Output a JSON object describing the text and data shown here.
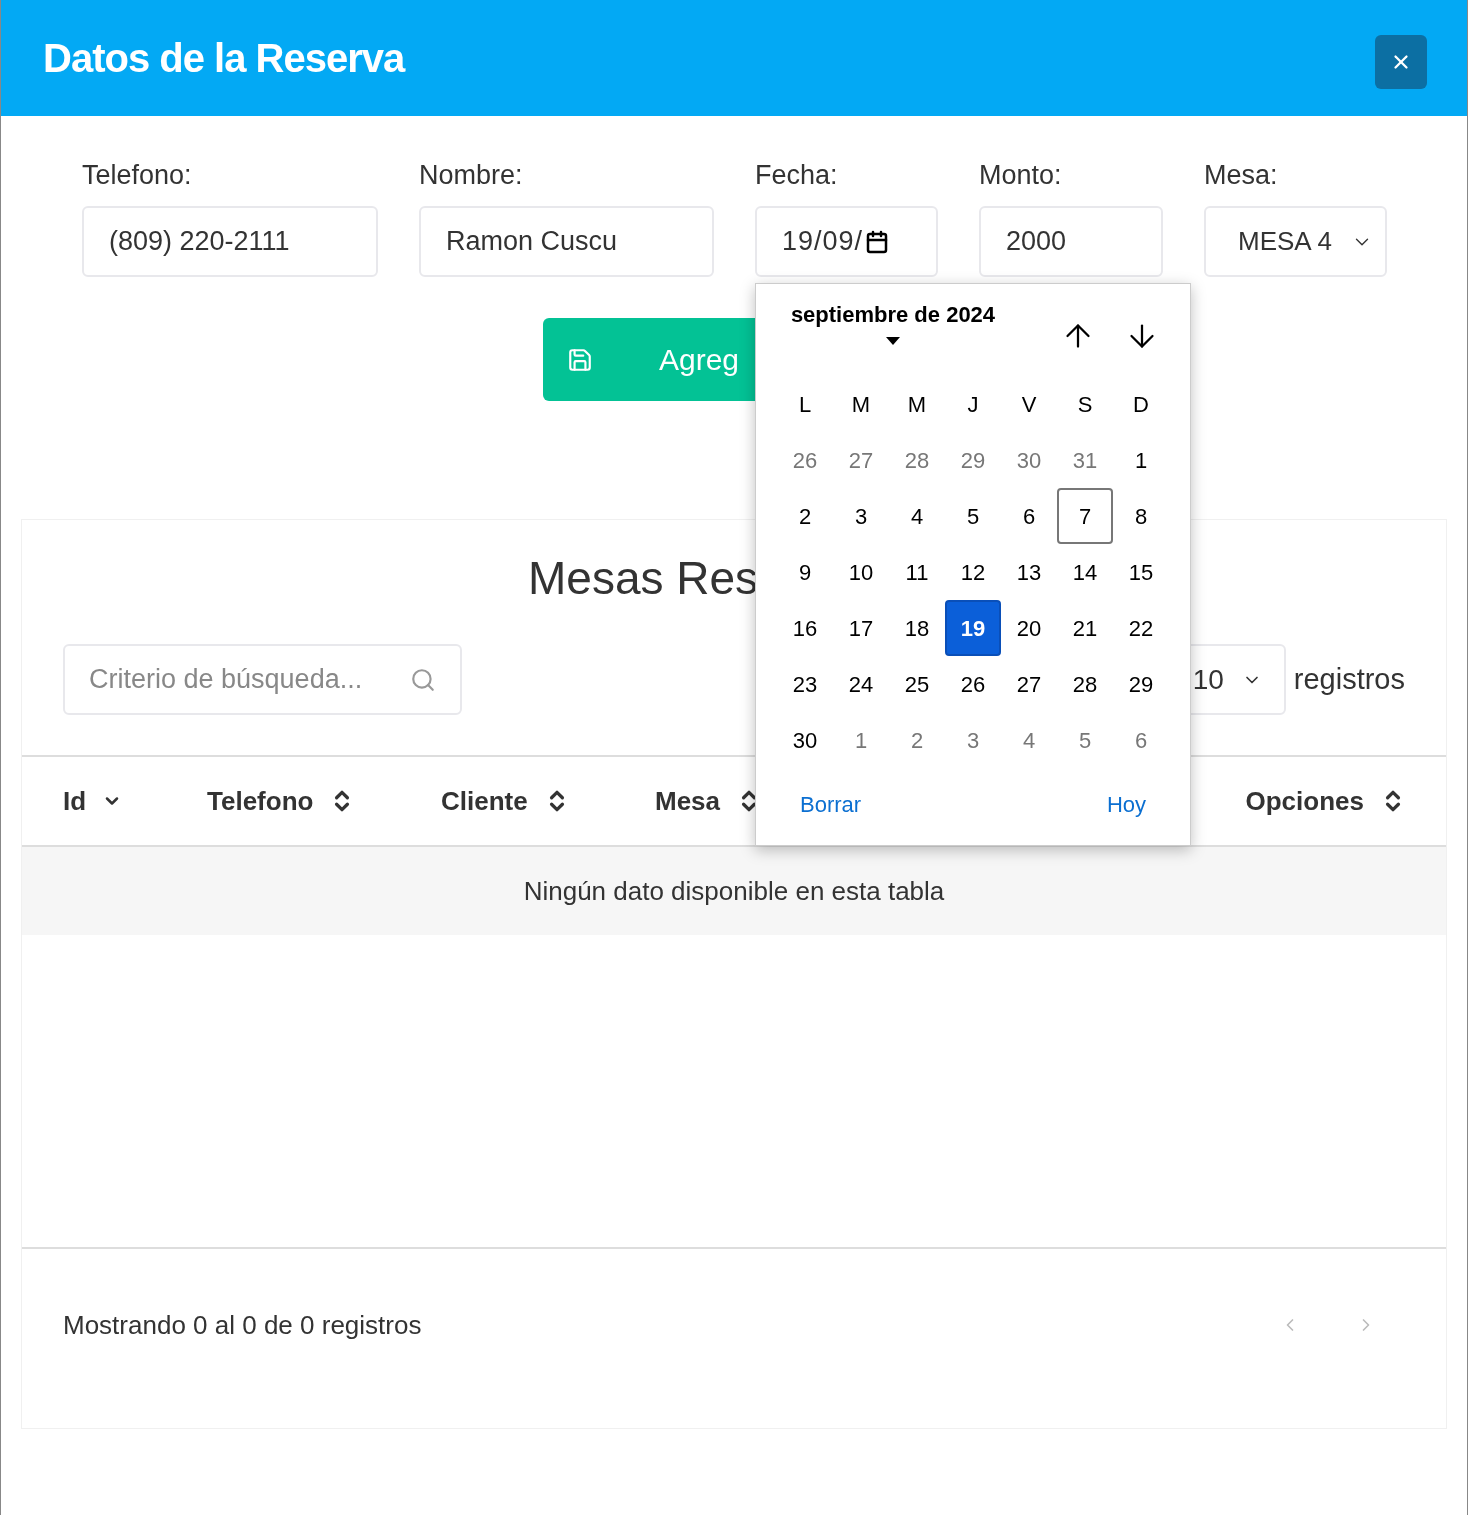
{
  "modal": {
    "title": "Datos de la Reserva"
  },
  "form": {
    "fields": [
      {
        "kind": "text",
        "label": "Telefono:",
        "value": "(809) 220-2111"
      },
      {
        "kind": "text",
        "label": "Nombre:",
        "value": "Ramon Cuscu"
      },
      {
        "kind": "date",
        "label": "Fecha:",
        "value": "19/09/"
      },
      {
        "kind": "text",
        "label": "Monto:",
        "value": "2000"
      },
      {
        "kind": "select",
        "label": "Mesa:",
        "value": "MESA 4"
      }
    ],
    "submit": "Agreg"
  },
  "table_card": {
    "title": "Mesas Res",
    "search": {
      "placeholder": "Criterio de búsqueda..."
    },
    "length": {
      "value": "10",
      "suffix": "registros"
    },
    "columns": [
      {
        "label": "Id",
        "sorted": true
      },
      {
        "label": "Telefono",
        "sorted": false
      },
      {
        "label": "Cliente",
        "sorted": false
      },
      {
        "label": "Mesa",
        "sorted": false
      },
      {
        "label": "Opciones",
        "sorted": false
      }
    ],
    "empty": "Ningún dato disponible en esta tabla",
    "info": "Mostrando 0 al 0 de 0 registros"
  },
  "datepicker": {
    "month": "septiembre de 2024",
    "weekdays": [
      "L",
      "M",
      "M",
      "J",
      "V",
      "S",
      "D"
    ],
    "days": [
      {
        "label": "26",
        "in_month": false,
        "today": false,
        "selected": false
      },
      {
        "label": "27",
        "in_month": false,
        "today": false,
        "selected": false
      },
      {
        "label": "28",
        "in_month": false,
        "today": false,
        "selected": false
      },
      {
        "label": "29",
        "in_month": false,
        "today": false,
        "selected": false
      },
      {
        "label": "30",
        "in_month": false,
        "today": false,
        "selected": false
      },
      {
        "label": "31",
        "in_month": false,
        "today": false,
        "selected": false
      },
      {
        "label": "1",
        "in_month": true,
        "today": false,
        "selected": false
      },
      {
        "label": "2",
        "in_month": true,
        "today": false,
        "selected": false
      },
      {
        "label": "3",
        "in_month": true,
        "today": false,
        "selected": false
      },
      {
        "label": "4",
        "in_month": true,
        "today": false,
        "selected": false
      },
      {
        "label": "5",
        "in_month": true,
        "today": false,
        "selected": false
      },
      {
        "label": "6",
        "in_month": true,
        "today": false,
        "selected": false
      },
      {
        "label": "7",
        "in_month": true,
        "today": true,
        "selected": false
      },
      {
        "label": "8",
        "in_month": true,
        "today": false,
        "selected": false
      },
      {
        "label": "9",
        "in_month": true,
        "today": false,
        "selected": false
      },
      {
        "label": "10",
        "in_month": true,
        "today": false,
        "selected": false
      },
      {
        "label": "11",
        "in_month": true,
        "today": false,
        "selected": false
      },
      {
        "label": "12",
        "in_month": true,
        "today": false,
        "selected": false
      },
      {
        "label": "13",
        "in_month": true,
        "today": false,
        "selected": false
      },
      {
        "label": "14",
        "in_month": true,
        "today": false,
        "selected": false
      },
      {
        "label": "15",
        "in_month": true,
        "today": false,
        "selected": false
      },
      {
        "label": "16",
        "in_month": true,
        "today": false,
        "selected": false
      },
      {
        "label": "17",
        "in_month": true,
        "today": false,
        "selected": false
      },
      {
        "label": "18",
        "in_month": true,
        "today": false,
        "selected": false
      },
      {
        "label": "19",
        "in_month": true,
        "today": false,
        "selected": true
      },
      {
        "label": "20",
        "in_month": true,
        "today": false,
        "selected": false
      },
      {
        "label": "21",
        "in_month": true,
        "today": false,
        "selected": false
      },
      {
        "label": "22",
        "in_month": true,
        "today": false,
        "selected": false
      },
      {
        "label": "23",
        "in_month": true,
        "today": false,
        "selected": false
      },
      {
        "label": "24",
        "in_month": true,
        "today": false,
        "selected": false
      },
      {
        "label": "25",
        "in_month": true,
        "today": false,
        "selected": false
      },
      {
        "label": "26",
        "in_month": true,
        "today": false,
        "selected": false
      },
      {
        "label": "27",
        "in_month": true,
        "today": false,
        "selected": false
      },
      {
        "label": "28",
        "in_month": true,
        "today": false,
        "selected": false
      },
      {
        "label": "29",
        "in_month": true,
        "today": false,
        "selected": false
      },
      {
        "label": "30",
        "in_month": true,
        "today": false,
        "selected": false
      },
      {
        "label": "1",
        "in_month": false,
        "today": false,
        "selected": false
      },
      {
        "label": "2",
        "in_month": false,
        "today": false,
        "selected": false
      },
      {
        "label": "3",
        "in_month": false,
        "today": false,
        "selected": false
      },
      {
        "label": "4",
        "in_month": false,
        "today": false,
        "selected": false
      },
      {
        "label": "5",
        "in_month": false,
        "today": false,
        "selected": false
      },
      {
        "label": "6",
        "in_month": false,
        "today": false,
        "selected": false
      }
    ],
    "clear": "Borrar",
    "today": "Hoy"
  }
}
